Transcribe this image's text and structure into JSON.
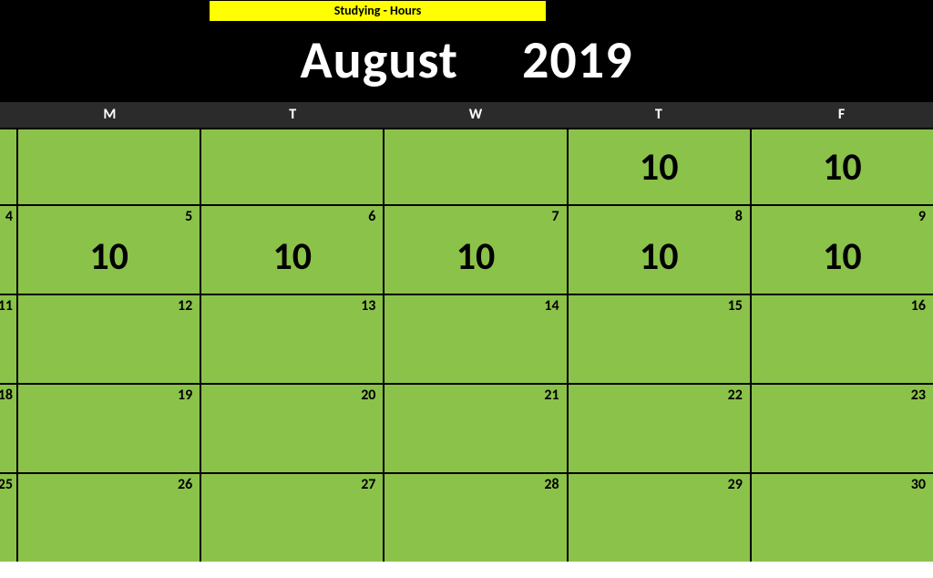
{
  "banner": "Studying - Hours",
  "month": "August",
  "year": "2019",
  "days": [
    "M",
    "T",
    "W",
    "T",
    "F"
  ],
  "weeks": [
    {
      "first": "",
      "cells": [
        {
          "num": "",
          "val": ""
        },
        {
          "num": "",
          "val": ""
        },
        {
          "num": "",
          "val": ""
        },
        {
          "num": "",
          "val": "10"
        },
        {
          "num": "",
          "val": "10"
        }
      ]
    },
    {
      "first": "4",
      "cells": [
        {
          "num": "5",
          "val": "10"
        },
        {
          "num": "6",
          "val": "10"
        },
        {
          "num": "7",
          "val": "10"
        },
        {
          "num": "8",
          "val": "10"
        },
        {
          "num": "9",
          "val": "10"
        }
      ]
    },
    {
      "first": "11",
      "cells": [
        {
          "num": "12",
          "val": ""
        },
        {
          "num": "13",
          "val": ""
        },
        {
          "num": "14",
          "val": ""
        },
        {
          "num": "15",
          "val": ""
        },
        {
          "num": "16",
          "val": ""
        }
      ]
    },
    {
      "first": "18",
      "cells": [
        {
          "num": "19",
          "val": ""
        },
        {
          "num": "20",
          "val": ""
        },
        {
          "num": "21",
          "val": ""
        },
        {
          "num": "22",
          "val": ""
        },
        {
          "num": "23",
          "val": ""
        }
      ]
    },
    {
      "first": "25",
      "cells": [
        {
          "num": "26",
          "val": ""
        },
        {
          "num": "27",
          "val": ""
        },
        {
          "num": "28",
          "val": ""
        },
        {
          "num": "29",
          "val": ""
        },
        {
          "num": "30",
          "val": ""
        }
      ]
    }
  ]
}
